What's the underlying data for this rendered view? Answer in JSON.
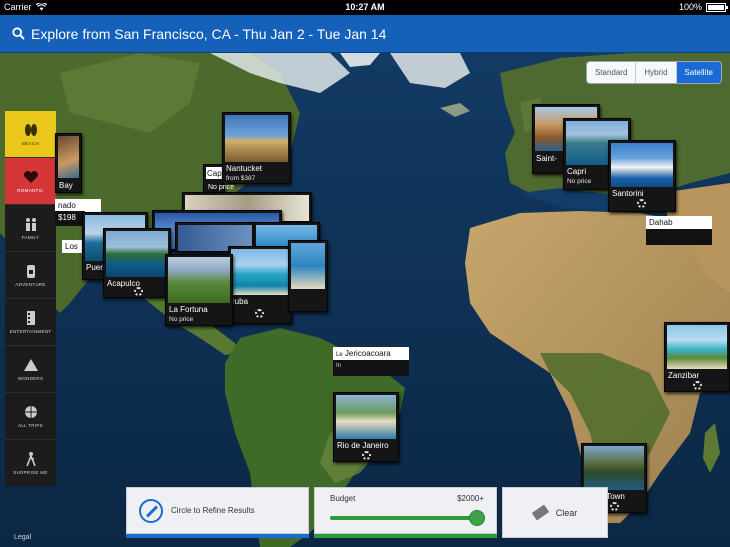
{
  "status_bar": {
    "carrier": "Carrier",
    "time": "10:27 AM",
    "battery_percent": "100%",
    "battery_level": 1.0
  },
  "search": {
    "text": "Explore from San Francisco, CA - Thu Jan 2 - Tue Jan 14"
  },
  "map_type": {
    "options": [
      "Standard",
      "Hybrid",
      "Satellite"
    ],
    "selected": "Satellite"
  },
  "map_legal": "Legal",
  "categories": [
    {
      "label": "BEACH",
      "icon": "flip-flops-icon",
      "color": "#e9c81b"
    },
    {
      "label": "ROMANTIC",
      "icon": "heart-icon",
      "color": "#d43638"
    },
    {
      "label": "FAMILY",
      "icon": "family-icon"
    },
    {
      "label": "ADVENTURE",
      "icon": "backpack-icon"
    },
    {
      "label": "ENTERTAINMENT",
      "icon": "film-strip-icon"
    },
    {
      "label": "WONDERS",
      "icon": "pyramid-icon"
    },
    {
      "label": "ALL TRIPS",
      "icon": "globe-icon"
    },
    {
      "label": "SURPRISE ME",
      "icon": "hiker-icon"
    }
  ],
  "destinations": {
    "nantucket": {
      "name": "Nantucket",
      "price": "from $387"
    },
    "no_price_label": "No price",
    "bay": {
      "name": "Bay"
    },
    "price_198": "$198",
    "nado": "nado",
    "los": "Los",
    "cap": "Cap",
    "puer": "Puer",
    "acapulco": {
      "name": "Acapulco"
    },
    "la_fortuna": {
      "name": "La Fortuna",
      "price": "No price"
    },
    "aruba": "ruba",
    "saint": "Saint-",
    "capri": {
      "name": "Capri",
      "price": "No price"
    },
    "santorini": {
      "name": "Santorini"
    },
    "dahab": {
      "name": "Dahab"
    },
    "jericoacoara": {
      "name": "Jericoacoara",
      "prefix": "Le",
      "suffix": "In"
    },
    "rio": {
      "name": "Rio de Janeiro"
    },
    "zanzibar": {
      "name": "Zanzibar"
    },
    "cape_town": {
      "name": "Cape Town"
    }
  },
  "toolbar": {
    "circle_label": "Circle to Refine Results",
    "budget_label": "Budget",
    "budget_value": "$2000+",
    "budget_level": 0.95,
    "clear_label": "Clear"
  },
  "colors": {
    "accent": "#1560b8",
    "beach": "#e9c81b",
    "romantic": "#d43638",
    "budget": "#2e9c3a"
  }
}
